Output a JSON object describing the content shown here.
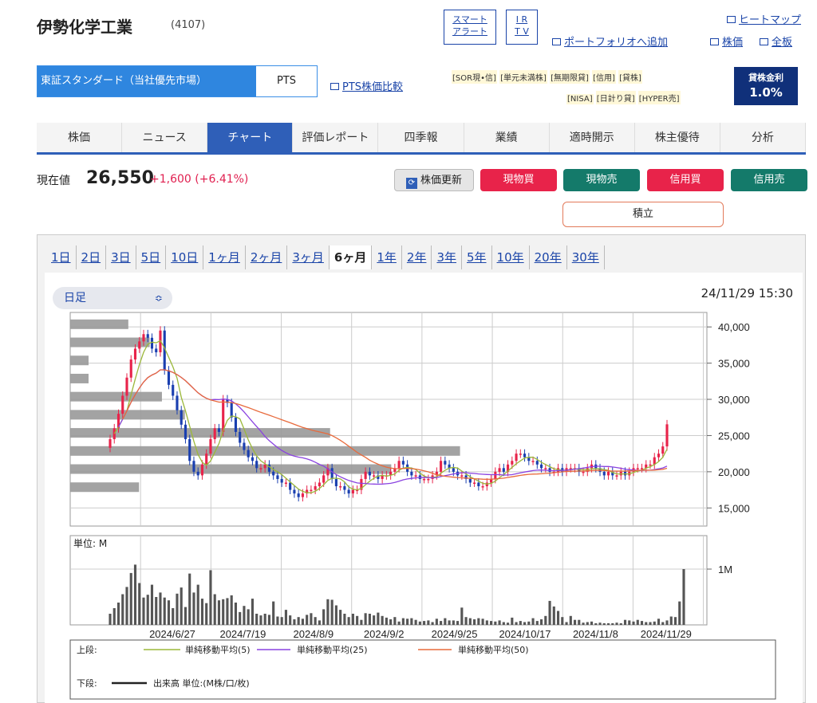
{
  "header": {
    "company": "伊勢化学工業",
    "code": "(4107)",
    "smart_alert": [
      "スマート",
      "アラート"
    ],
    "irtv": [
      "I R",
      "T V"
    ],
    "heatmap": "ヒートマップ",
    "portfolio": "ポートフォリオへ追加",
    "kabuka": "株価",
    "zenita": "全板"
  },
  "market": {
    "primary": "東証スタンダード（当社優先市場）",
    "pts": "PTS",
    "pts_compare": "PTS株価比較"
  },
  "tags": {
    "row1": [
      "[SOR現•信]",
      "[単元未満株]",
      "[無期限貸]",
      "[信用]",
      "[貸株]"
    ],
    "row2": [
      "[NISA]",
      "[日計り貸]",
      "[HYPER売]"
    ]
  },
  "lend": {
    "label": "貸株金利",
    "rate": "1.0%"
  },
  "nav": [
    "株価",
    "ニュース",
    "チャート",
    "評価レポート",
    "四季報",
    "業績",
    "適時開示",
    "株主優待",
    "分析"
  ],
  "nav_active": 2,
  "quote": {
    "label": "現在値",
    "price": "26,550",
    "change": "+1,600",
    "change_pct": "(+6.41%)"
  },
  "actions": {
    "update": "株価更新",
    "genbutsu_buy": "現物買",
    "genbutsu_sell": "現物売",
    "shinyo_buy": "信用買",
    "shinyo_sell": "信用売",
    "tsumitate": "積立"
  },
  "periods": [
    "1日",
    "2日",
    "3日",
    "5日",
    "10日",
    "1ヶ月",
    "2ヶ月",
    "3ヶ月",
    "6ヶ月",
    "1年",
    "2年",
    "3年",
    "5年",
    "10年",
    "20年",
    "30年"
  ],
  "period_selected": 8,
  "chart_control": {
    "interval": "日足",
    "timestamp": "24/11/29 15:30"
  },
  "chart_data": {
    "type": "candlestick",
    "price_axis": {
      "ticks": [
        15000,
        20000,
        25000,
        30000,
        35000,
        40000
      ],
      "labels": [
        "15,000",
        "20,000",
        "25,000",
        "30,000",
        "35,000",
        "40,000"
      ],
      "range": [
        12500,
        42000
      ]
    },
    "volume_axis": {
      "unit_label": "単位: M",
      "tick_label": "1M",
      "tick": 1.0,
      "range": [
        0,
        1.6
      ]
    },
    "date_labels": [
      "2024/6/27",
      "2024/7/19",
      "2024/8/9",
      "2024/9/2",
      "2024/9/25",
      "2024/10/17",
      "2024/11/8",
      "2024/11/29"
    ],
    "up_color": "#e8234a",
    "down_color": "#1a3fb0",
    "closes": [
      24500,
      26000,
      28000,
      30500,
      33000,
      35500,
      37000,
      38000,
      39000,
      38500,
      37000,
      36500,
      39500,
      34000,
      32000,
      30500,
      28500,
      26500,
      24500,
      21500,
      20000,
      19500,
      21000,
      22500,
      24500,
      26000,
      25500,
      30000,
      29500,
      27500,
      25500,
      24000,
      23000,
      22000,
      21500,
      20500,
      20500,
      21000,
      20000,
      19500,
      19000,
      18500,
      18500,
      17500,
      17000,
      16500,
      17000,
      17500,
      17500,
      18000,
      18500,
      19500,
      20500,
      19000,
      18000,
      18000,
      17500,
      17000,
      17500,
      17500,
      19000,
      20000,
      19500,
      19500,
      19000,
      19500,
      19500,
      20000,
      20500,
      21500,
      21000,
      20000,
      19500,
      19500,
      19000,
      19000,
      19000,
      19500,
      20000,
      21500,
      21000,
      20500,
      20000,
      19500,
      19500,
      19000,
      18500,
      18500,
      18000,
      18000,
      18500,
      19000,
      20000,
      20500,
      20000,
      21000,
      21500,
      22500,
      22500,
      22000,
      21500,
      21500,
      21000,
      20500,
      20500,
      20000,
      20000,
      20500,
      20000,
      20500,
      20500,
      20500,
      20000,
      20000,
      20500,
      21000,
      20500,
      20000,
      19500,
      20000,
      19500,
      19500,
      20000,
      19500,
      20000,
      20500,
      20500,
      20500,
      21000,
      21000,
      22000,
      22500,
      23500,
      26550
    ],
    "volumes": [
      0.2,
      0.3,
      0.4,
      0.55,
      0.68,
      0.93,
      1.08,
      0.75,
      0.49,
      0.54,
      0.72,
      0.5,
      0.58,
      0.49,
      0.44,
      0.3,
      0.56,
      0.67,
      0.32,
      0.92,
      0.58,
      0.72,
      0.47,
      0.39,
      0.98,
      0.55,
      0.44,
      0.46,
      0.48,
      0.53,
      0.4,
      0.23,
      0.34,
      0.28,
      0.47,
      0.2,
      0.17,
      0.2,
      0.18,
      0.42,
      0.15,
      0.14,
      0.27,
      0.17,
      0.1,
      0.14,
      0.11,
      0.18,
      0.21,
      0.14,
      0.08,
      0.28,
      0.46,
      0.45,
      0.35,
      0.27,
      0.2,
      0.14,
      0.2,
      0.16,
      0.09,
      0.21,
      0.2,
      0.17,
      0.22,
      0.16,
      0.13,
      0.1,
      0.14,
      0.06,
      0.12,
      0.11,
      0.12,
      0.09,
      0.06,
      0.07,
      0.08,
      0.05,
      0.11,
      0.07,
      0.12,
      0.08,
      0.08,
      0.07,
      0.31,
      0.14,
      0.12,
      0.1,
      0.12,
      0.11,
      0.08,
      0.07,
      0.06,
      0.08,
      0.05,
      0.04,
      0.13,
      0.05,
      0.07,
      0.05,
      0.06,
      0.12,
      0.07,
      0.1,
      0.16,
      0.43,
      0.33,
      0.25,
      0.14,
      0.05,
      0.16,
      0.09,
      0.09,
      0.04,
      0.05,
      0.06,
      0.03,
      0.04,
      0.03,
      0.03,
      0.03,
      0.04,
      0.03,
      0.09,
      0.08,
      0.06,
      0.09,
      0.07,
      0.05,
      0.05,
      0.06,
      0.11,
      0.05,
      0.08,
      0.15,
      0.14,
      0.42,
      1.0
    ],
    "volume_profile": [
      {
        "price": 40000,
        "volume": 38
      },
      {
        "price": 37500,
        "volume": 52
      },
      {
        "price": 35000,
        "volume": 12
      },
      {
        "price": 32500,
        "volume": 12
      },
      {
        "price": 30000,
        "volume": 60
      },
      {
        "price": 27500,
        "volume": 75
      },
      {
        "price": 25000,
        "volume": 170
      },
      {
        "price": 22500,
        "volume": 255
      },
      {
        "price": 20000,
        "volume": 210
      },
      {
        "price": 17500,
        "volume": 45
      }
    ],
    "ma_colors": {
      "ma5": "#9bb83a",
      "ma25": "#8a42e0",
      "ma50": "#e86a3c"
    },
    "legend": {
      "upper_label": "上段:",
      "ma5": "単純移動平均(5)",
      "ma25": "単純移動平均(25)",
      "ma50": "単純移動平均(50)",
      "lower_label": "下段:",
      "volume": "出来高 単位:(M株/口/枚)"
    }
  }
}
